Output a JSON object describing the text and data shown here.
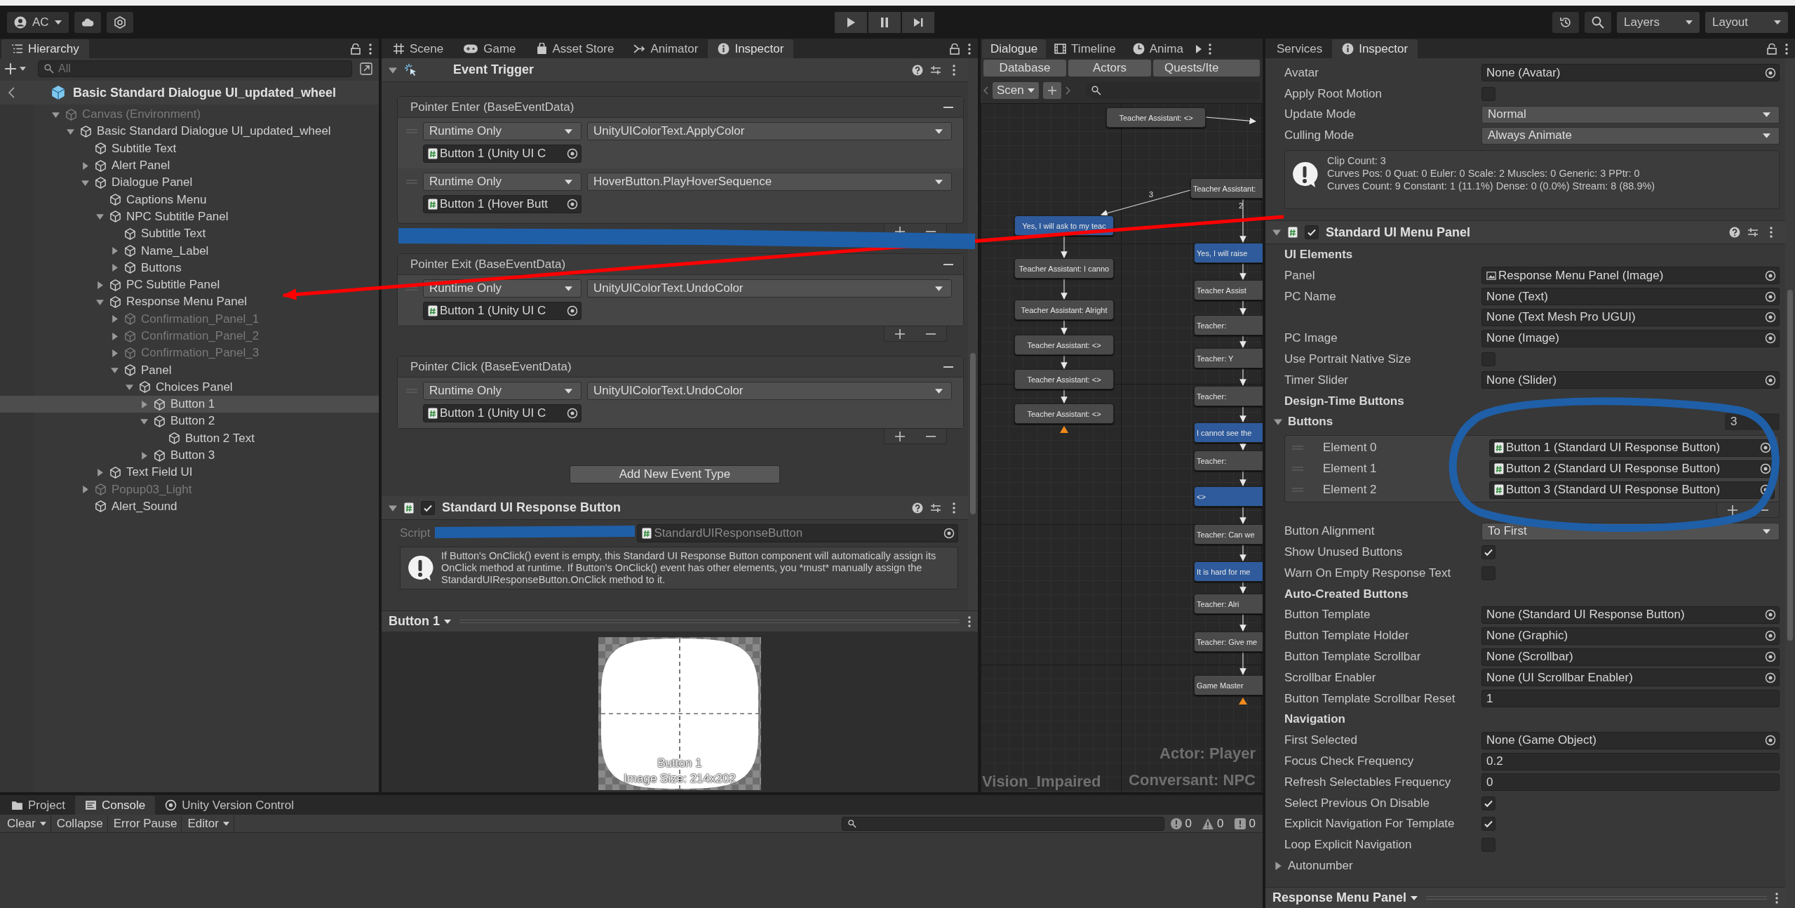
{
  "toolbar": {
    "account": "AC",
    "layers": "Layers",
    "layout": "Layout"
  },
  "hierarchy": {
    "tab": "Hierarchy",
    "search_placeholder": "All",
    "prefab_title": "Basic Standard Dialogue UI_updated_wheel",
    "tree": [
      {
        "name": "Canvas (Environment)",
        "kind": "group",
        "expanded": true,
        "active": false,
        "selected": false,
        "children": [
          {
            "name": "Basic Standard Dialogue UI_updated_wheel",
            "kind": "group",
            "expanded": true,
            "active": true,
            "selected": false,
            "children": [
              {
                "name": "Subtitle Text",
                "kind": "leaf",
                "active": true,
                "selected": false
              },
              {
                "name": "Alert Panel",
                "kind": "group",
                "expanded": false,
                "active": true,
                "selected": false
              },
              {
                "name": "Dialogue Panel",
                "kind": "group",
                "expanded": true,
                "active": true,
                "selected": false,
                "children": [
                  {
                    "name": "Captions Menu",
                    "kind": "leaf",
                    "active": true,
                    "selected": false
                  },
                  {
                    "name": "NPC Subtitle Panel",
                    "kind": "group",
                    "expanded": true,
                    "active": true,
                    "selected": false,
                    "children": [
                      {
                        "name": "Subtitle Text",
                        "kind": "leaf",
                        "active": true,
                        "selected": false
                      },
                      {
                        "name": "Name_Label",
                        "kind": "group",
                        "expanded": false,
                        "active": true,
                        "selected": false
                      },
                      {
                        "name": "Buttons",
                        "kind": "group",
                        "expanded": false,
                        "active": true,
                        "selected": false
                      }
                    ]
                  },
                  {
                    "name": "PC Subtitle Panel",
                    "kind": "group",
                    "expanded": false,
                    "active": true,
                    "selected": false
                  },
                  {
                    "name": "Response Menu Panel",
                    "kind": "group",
                    "expanded": true,
                    "active": true,
                    "selected": false,
                    "children": [
                      {
                        "name": "Confirmation_Panel_1",
                        "kind": "group",
                        "expanded": false,
                        "active": false,
                        "selected": false
                      },
                      {
                        "name": "Confirmation_Panel_2",
                        "kind": "group",
                        "expanded": false,
                        "active": false,
                        "selected": false
                      },
                      {
                        "name": "Confirmation_Panel_3",
                        "kind": "group",
                        "expanded": false,
                        "active": false,
                        "selected": false
                      },
                      {
                        "name": "Panel",
                        "kind": "group",
                        "expanded": true,
                        "active": true,
                        "selected": false,
                        "children": [
                          {
                            "name": "Choices Panel",
                            "kind": "group",
                            "expanded": true,
                            "active": true,
                            "selected": false,
                            "children": [
                              {
                                "name": "Button 1",
                                "kind": "group",
                                "expanded": false,
                                "active": true,
                                "selected": true
                              },
                              {
                                "name": "Button 2",
                                "kind": "group",
                                "expanded": true,
                                "active": true,
                                "selected": false,
                                "children": [
                                  {
                                    "name": "Button 2 Text",
                                    "kind": "leaf",
                                    "active": true,
                                    "selected": false
                                  }
                                ]
                              },
                              {
                                "name": "Button 3",
                                "kind": "group",
                                "expanded": false,
                                "active": true,
                                "selected": false
                              }
                            ]
                          }
                        ]
                      }
                    ]
                  },
                  {
                    "name": "Text Field UI",
                    "kind": "group",
                    "expanded": false,
                    "active": true,
                    "selected": false
                  }
                ]
              },
              {
                "name": "Popup03_Light",
                "kind": "group",
                "expanded": false,
                "active": false,
                "selected": false
              },
              {
                "name": "Alert_Sound",
                "kind": "leaf",
                "active": true,
                "selected": false
              }
            ]
          }
        ]
      }
    ]
  },
  "scene_inspector": {
    "tabs": [
      {
        "label": "Scene",
        "selected": false
      },
      {
        "label": "Game",
        "selected": false
      },
      {
        "label": "Asset Store",
        "selected": false
      },
      {
        "label": "Animator",
        "selected": false
      },
      {
        "label": "Inspector",
        "selected": true
      }
    ],
    "event_trigger": {
      "title": "Event Trigger",
      "expanded": true,
      "events": [
        {
          "title": "Pointer Enter (BaseEventData)",
          "entries": [
            {
              "mode": "Runtime Only",
              "function": "UnityUIColorText.ApplyColor",
              "target": "Button 1 (Unity UI C"
            },
            {
              "mode": "Runtime Only",
              "function": "HoverButton.PlayHoverSequence",
              "target": "Button 1 (Hover Butt"
            }
          ]
        },
        {
          "title": "Pointer Exit (BaseEventData)",
          "entries": [
            {
              "mode": "Runtime Only",
              "function": "UnityUIColorText.UndoColor",
              "target": "Button 1 (Unity UI C"
            }
          ]
        },
        {
          "title": "Pointer Click (BaseEventData)",
          "entries": [
            {
              "mode": "Runtime Only",
              "function": "UnityUIColorText.UndoColor",
              "target": "Button 1 (Unity UI C"
            }
          ]
        }
      ],
      "add_button": "Add New Event Type"
    },
    "response_button": {
      "title": "Standard UI Response Button",
      "expanded": true,
      "enabled": true,
      "script_label": "Script",
      "script": "StandardUIResponseButton",
      "help": "If Button's OnClick() event is empty, this Standard UI Response Button component will automatically assign its OnClick method at runtime. If Button's OnClick() event has other elements, you *must* manually assign the StandardUIResponseButton.OnClick method to it."
    },
    "preview": {
      "title": "Button 1",
      "name": "Button 1",
      "size": "Image Size: 214x202"
    }
  },
  "dialogue_editor": {
    "tabs": [
      {
        "label": "Dialogue",
        "selected": true
      },
      {
        "label": "Timeline",
        "selected": false
      },
      {
        "label": "Anima",
        "selected": false
      }
    ],
    "sub_tabs": [
      "Database",
      "Actors",
      "Quests/Ite"
    ],
    "conversation_dropdown": "Scen",
    "nodes": [
      {
        "text": "Teacher Assistant: <>",
        "kind": "npc"
      },
      {
        "text": "Teacher Assistant:",
        "kind": "npc"
      },
      {
        "text": "Yes, I will ask to my teac",
        "kind": "response"
      },
      {
        "text": "Teacher Assistant: I canno",
        "kind": "npc"
      },
      {
        "text": "Teacher Assistant: Alright",
        "kind": "npc"
      },
      {
        "text": "Teacher Assistant: <>",
        "kind": "npc"
      },
      {
        "text": "Teacher Assistant: <>",
        "kind": "npc"
      },
      {
        "text": "Teacher Assistant: <>",
        "kind": "npc"
      },
      {
        "text": "Yes, I will raise",
        "kind": "response"
      },
      {
        "text": "Teacher Assist",
        "kind": "npc"
      },
      {
        "text": "Teacher:",
        "kind": "npc"
      },
      {
        "text": "Teacher: Y",
        "kind": "npc"
      },
      {
        "text": "Teacher:",
        "kind": "npc"
      },
      {
        "text": "I cannot see the",
        "kind": "response"
      },
      {
        "text": "Teacher:",
        "kind": "npc"
      },
      {
        "text": "<>",
        "kind": "response"
      },
      {
        "text": "Teacher: Can we",
        "kind": "npc"
      },
      {
        "text": "It is hard for me",
        "kind": "response"
      },
      {
        "text": "Teacher: Alri",
        "kind": "npc"
      },
      {
        "text": "Teacher: Give me",
        "kind": "npc"
      },
      {
        "text": "Game Master",
        "kind": "npc"
      }
    ],
    "edge_labels": [
      "3",
      "2"
    ],
    "actor": "Actor: Player",
    "conversant": "Conversant: NPC",
    "conversation": "Vision_Impaired"
  },
  "inspector": {
    "tabs": [
      {
        "label": "Services",
        "selected": false
      },
      {
        "label": "Inspector",
        "selected": true
      }
    ],
    "rows": [
      {
        "kind": "object",
        "label": "Avatar",
        "value": "None (Avatar)"
      },
      {
        "kind": "checkbox",
        "label": "Apply Root Motion",
        "checked": false
      },
      {
        "kind": "dropdown",
        "label": "Update Mode",
        "value": "Normal"
      },
      {
        "kind": "dropdown",
        "label": "Culling Mode",
        "value": "Always Animate"
      },
      {
        "kind": "help",
        "lines": [
          "Clip Count: 3",
          "Curves Pos: 0 Quat: 0 Euler: 0 Scale: 2 Muscles: 0 Generic: 3 PPtr: 0",
          "Curves Count: 9 Constant: 1 (11.1%) Dense: 0 (0.0%) Stream: 8 (88.9%)"
        ]
      },
      {
        "kind": "component",
        "title": "Standard UI Menu Panel",
        "enabled": true,
        "expanded": true
      },
      {
        "kind": "section",
        "label": "UI Elements"
      },
      {
        "kind": "image_object",
        "label": "Panel",
        "value": "Response Menu Panel (Image)"
      },
      {
        "kind": "object",
        "label": "PC Name",
        "value": "None (Text)"
      },
      {
        "kind": "object",
        "value": "None (Text Mesh Pro UGUI)"
      },
      {
        "kind": "object",
        "label": "PC Image",
        "value": "None (Image)"
      },
      {
        "kind": "checkbox",
        "label": "Use Portrait Native Size",
        "checked": false
      },
      {
        "kind": "object",
        "label": "Timer Slider",
        "value": "None (Slider)"
      },
      {
        "kind": "section",
        "label": "Design-Time Buttons"
      },
      {
        "kind": "list",
        "label": "Buttons",
        "count": "3",
        "expanded": true,
        "elements": [
          {
            "label": "Element 0",
            "value": "Button 1 (Standard UI Response Button)"
          },
          {
            "label": "Element 1",
            "value": "Button 2 (Standard UI Response Button)"
          },
          {
            "label": "Element 2",
            "value": "Button 3 (Standard UI Response Button)"
          }
        ]
      },
      {
        "kind": "dropdown",
        "label": "Button Alignment",
        "value": "To First"
      },
      {
        "kind": "checkbox",
        "label": "Show Unused Buttons",
        "checked": true
      },
      {
        "kind": "checkbox",
        "label": "Warn On Empty Response Text",
        "checked": false
      },
      {
        "kind": "section",
        "label": "Auto-Created Buttons"
      },
      {
        "kind": "object",
        "label": "Button Template",
        "value": "None (Standard UI Response Button)"
      },
      {
        "kind": "object",
        "label": "Button Template Holder",
        "value": "None (Graphic)"
      },
      {
        "kind": "object",
        "label": "Button Template Scrollbar",
        "value": "None (Scrollbar)"
      },
      {
        "kind": "object",
        "label": "Scrollbar Enabler",
        "value": "None (UI Scrollbar Enabler)"
      },
      {
        "kind": "field",
        "label": "Button Template Scrollbar Reset",
        "value": "1"
      },
      {
        "kind": "section",
        "label": "Navigation"
      },
      {
        "kind": "object",
        "label": "First Selected",
        "value": "None (Game Object)"
      },
      {
        "kind": "field",
        "label": "Focus Check Frequency",
        "value": "0.2"
      },
      {
        "kind": "field",
        "label": "Refresh Selectables Frequency",
        "value": "0"
      },
      {
        "kind": "checkbox",
        "label": "Select Previous On Disable",
        "checked": true
      },
      {
        "kind": "checkbox",
        "label": "Explicit Navigation For Template",
        "checked": true
      },
      {
        "kind": "checkbox",
        "label": "Loop Explicit Navigation",
        "checked": false
      },
      {
        "kind": "foldout",
        "label": "Autonumber",
        "expanded": false
      }
    ],
    "footer": "Response Menu Panel"
  },
  "console": {
    "tabs": [
      {
        "label": "Project",
        "selected": false
      },
      {
        "label": "Console",
        "selected": true
      },
      {
        "label": "Unity Version Control",
        "selected": false
      }
    ],
    "clear": "Clear",
    "collapse": "Collapse",
    "error_pause": "Error Pause",
    "editor": "Editor",
    "counts": [
      {
        "kind": "info",
        "count": "0"
      },
      {
        "kind": "warning",
        "count": "0"
      },
      {
        "kind": "error",
        "count": "0"
      }
    ]
  }
}
